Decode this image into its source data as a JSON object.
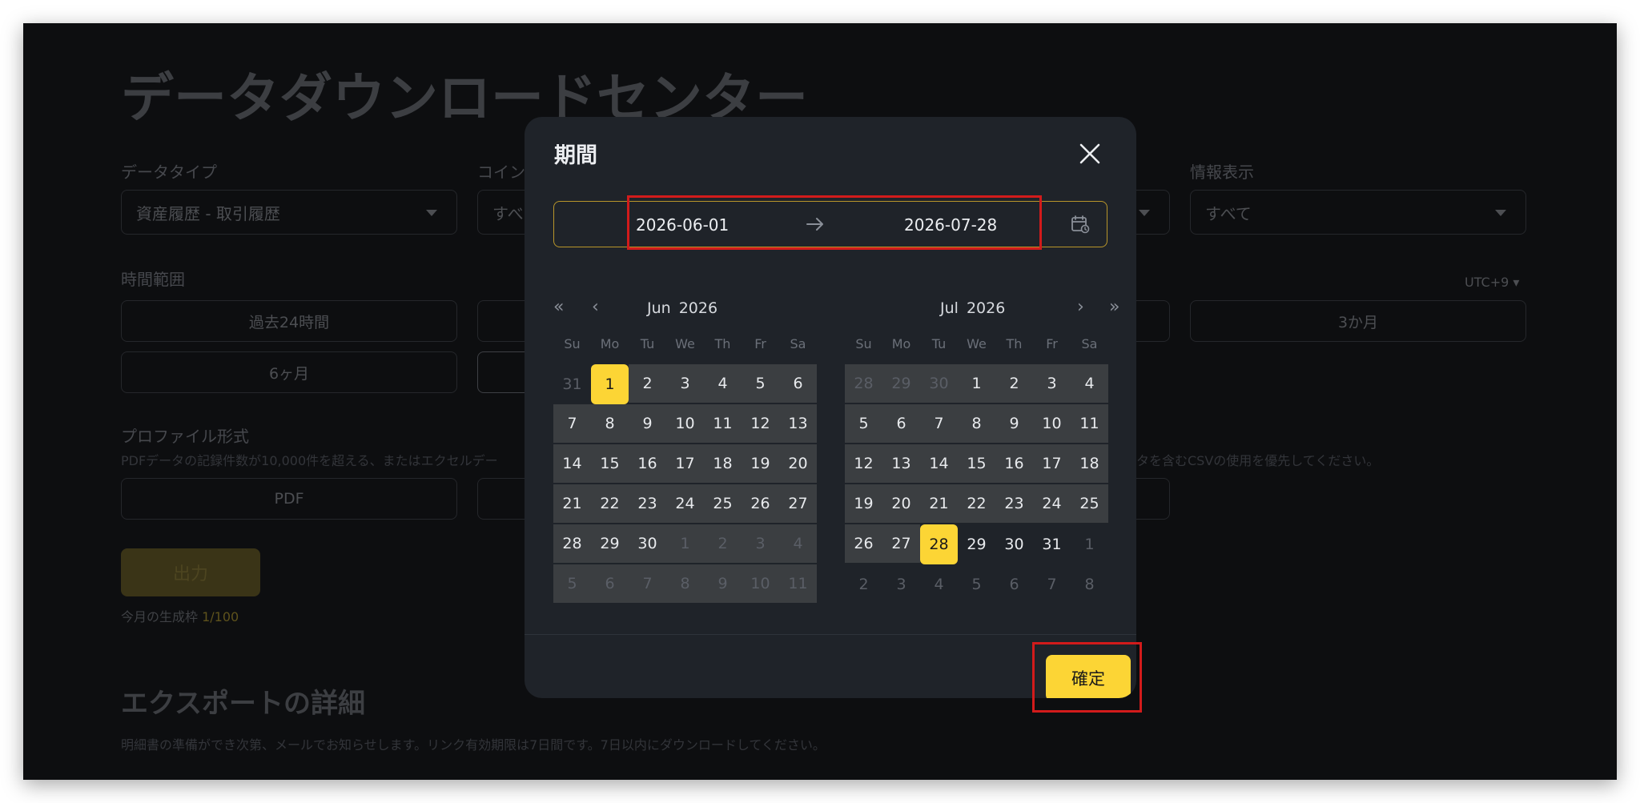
{
  "page": {
    "title": "データダウンロードセンター",
    "data_type_label": "データタイプ",
    "data_type_value": "資産履歴 - 取引履歴",
    "coin_label": "コイン",
    "coin_value": "すべ",
    "info_label": "情報表示",
    "info_value": "すべて",
    "time_range_label": "時間範囲",
    "timezone": "UTC+9",
    "time_options": [
      "過去24時間",
      "6ヶ月",
      "3か月"
    ],
    "profile_label": "プロファイル形式",
    "profile_hint_left": "PDFデータの記録件数が10,000件を超える、またはエクセルデー",
    "profile_hint_right": "タを含むCSVの使用を優先してください。",
    "pdf_option": "PDF",
    "export_button": "出力",
    "quota_label": "今月の生成枠",
    "quota_value": "1/100",
    "export_details_title": "エクスポートの詳細",
    "export_details_desc": "明細書の準備ができ次第、メールでお知らせします。リンク有効期限は7日間です。7日以内にダウンロードしてください。"
  },
  "modal": {
    "title": "期間",
    "start_date": "2026-06-01",
    "end_date": "2026-07-28",
    "confirm_button": "確定",
    "weekdays": [
      "Su",
      "Mo",
      "Tu",
      "We",
      "Th",
      "Fr",
      "Sa"
    ],
    "calendars": [
      {
        "month": "Jun",
        "year": "2026",
        "days": [
          "31",
          "1",
          "2",
          "3",
          "4",
          "5",
          "6",
          "7",
          "8",
          "9",
          "10",
          "11",
          "12",
          "13",
          "14",
          "15",
          "16",
          "17",
          "18",
          "19",
          "20",
          "21",
          "22",
          "23",
          "24",
          "25",
          "26",
          "27",
          "28",
          "29",
          "30",
          "1",
          "2",
          "3",
          "4",
          "5",
          "6",
          "7",
          "8",
          "9",
          "10",
          "11"
        ],
        "first_in_month": 1,
        "last_in_month": 30,
        "selected": 1,
        "range_from": 1,
        "range_to": 41
      },
      {
        "month": "Jul",
        "year": "2026",
        "days": [
          "28",
          "29",
          "30",
          "1",
          "2",
          "3",
          "4",
          "5",
          "6",
          "7",
          "8",
          "9",
          "10",
          "11",
          "12",
          "13",
          "14",
          "15",
          "16",
          "17",
          "18",
          "19",
          "20",
          "21",
          "22",
          "23",
          "24",
          "25",
          "26",
          "27",
          "28",
          "29",
          "30",
          "31",
          "1",
          "2",
          "3",
          "4",
          "5",
          "6",
          "7",
          "8"
        ],
        "first_in_month": 3,
        "last_in_month": 33,
        "selected": 30,
        "range_from": 0,
        "range_to": 30
      }
    ]
  },
  "colors": {
    "accent": "#fcd535",
    "modal_bg": "#1f2329",
    "highlight": "#d21b1b"
  }
}
